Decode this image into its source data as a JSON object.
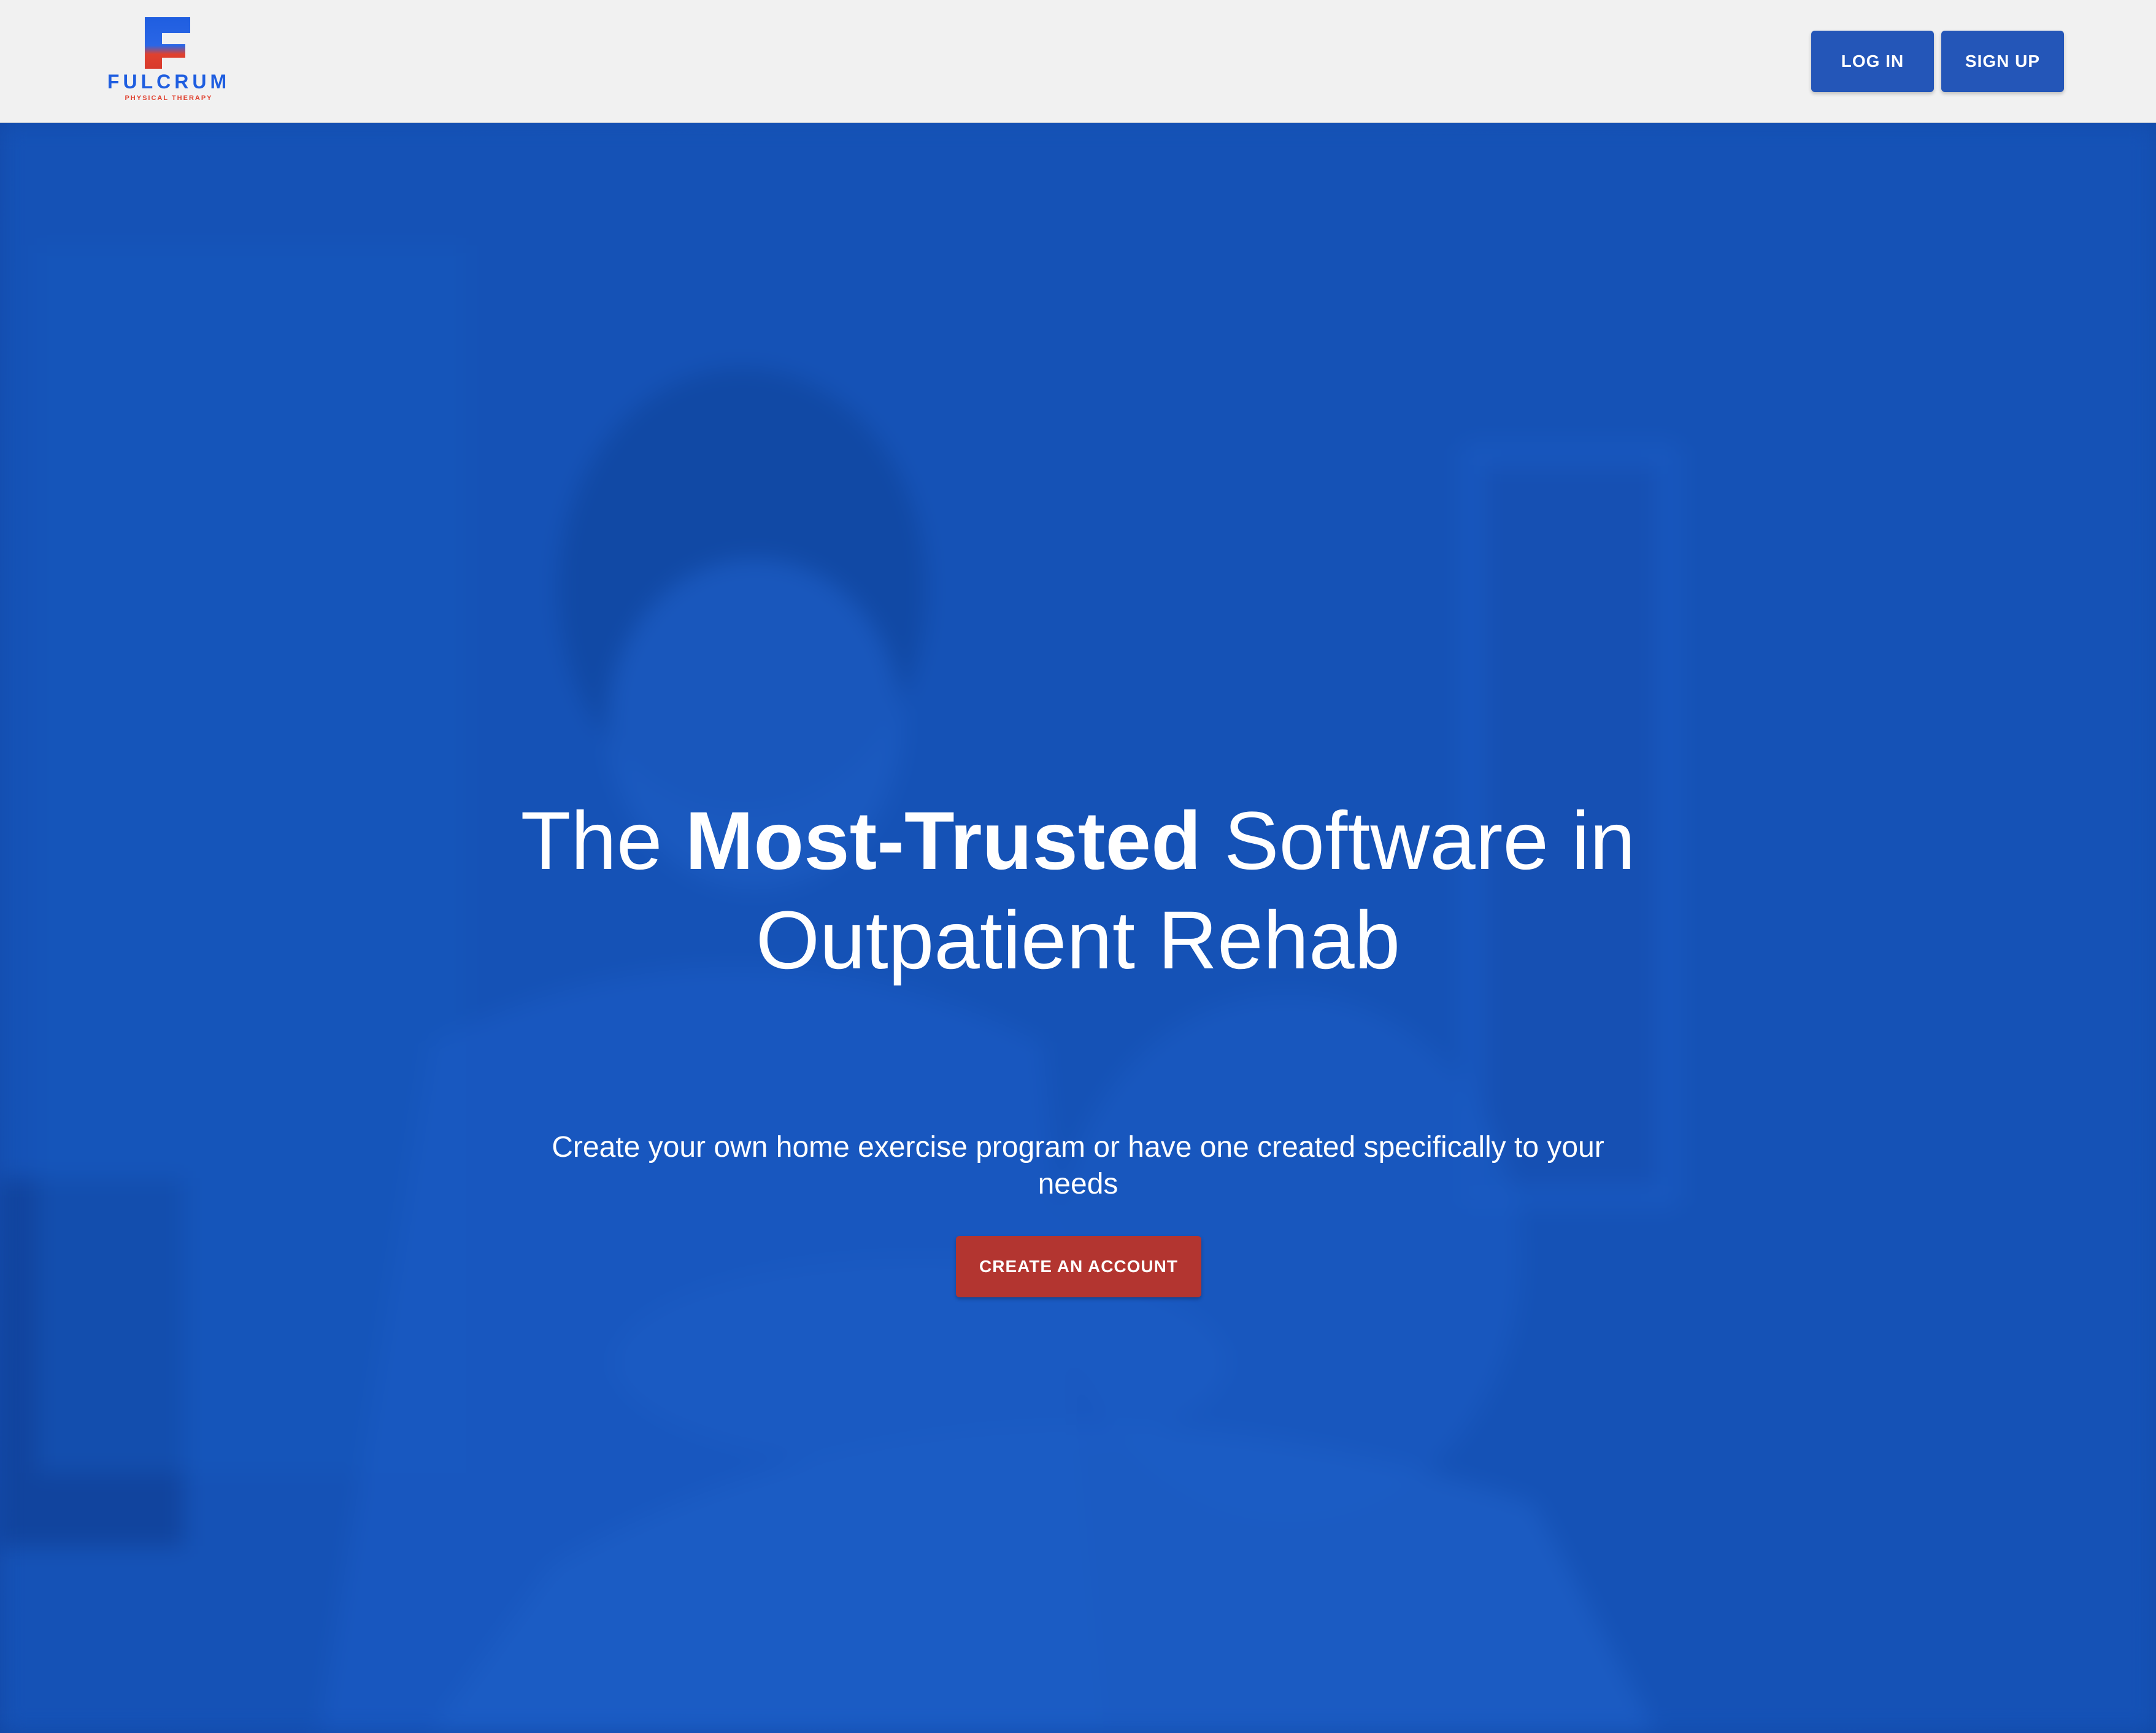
{
  "header": {
    "logo": {
      "wordmark": "FULCRUM",
      "tagline": "PHYSICAL THERAPY",
      "icon": "fulcrum-f-logo-icon"
    },
    "login_label": "LOG IN",
    "signup_label": "SIGN UP"
  },
  "hero": {
    "title_pre": "The ",
    "title_bold": "Most-Trusted",
    "title_mid": " Software in",
    "title_line2": "Outpatient Rehab",
    "subtitle": "Create your own home exercise program or have one created specifically to your needs",
    "cta_label": "CREATE AN ACCOUNT",
    "background_image": "therapist-treating-patient-photo"
  },
  "colors": {
    "header_bg": "#f1f1f1",
    "brand_blue": "#2456b8",
    "hero_overlay": "#1450b0",
    "cta_red": "#b33530",
    "logo_blue": "#1f5ee0",
    "logo_red": "#e0412f"
  }
}
